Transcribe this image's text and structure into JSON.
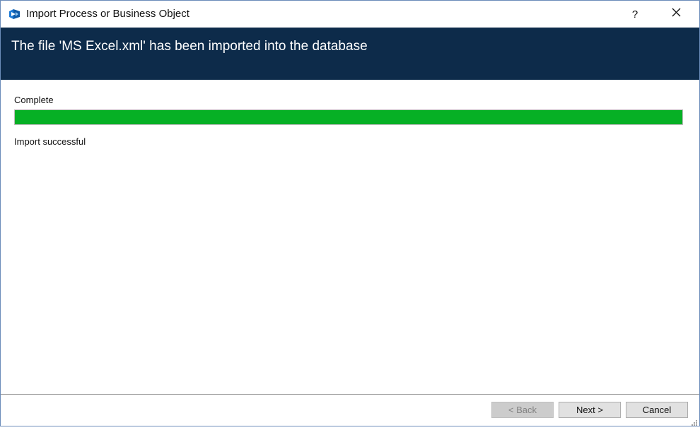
{
  "window": {
    "title": "Import Process or Business Object",
    "help_label": "?",
    "icons": {
      "app": "app-logo-icon",
      "close": "close-icon",
      "grip": "resize-grip-icon"
    }
  },
  "banner": {
    "heading": "The file 'MS Excel.xml' has been imported into the database"
  },
  "progress": {
    "status_label": "Complete",
    "value": 1.0,
    "result_text": "Import successful"
  },
  "footer": {
    "back_label": "< Back",
    "next_label": "Next >",
    "cancel_label": "Cancel"
  },
  "colors": {
    "banner_bg": "#0d2b4a",
    "progress_fill": "#06b025",
    "app_icon_blue": "#1e7bd6"
  }
}
